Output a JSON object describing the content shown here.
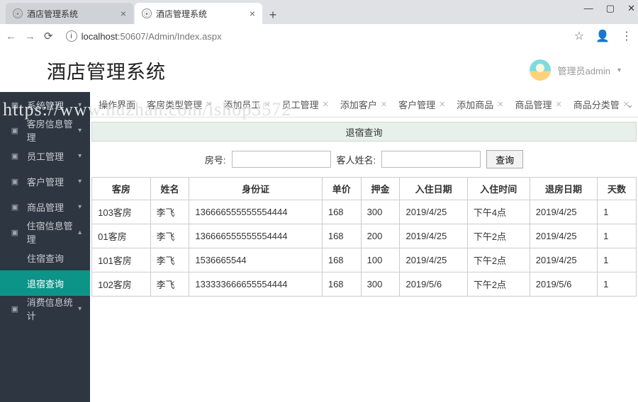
{
  "browser": {
    "tab1_title": "酒店管理系统",
    "tab2_title": "酒店管理系统",
    "url_host": "localhost",
    "url_rest": ":50607/Admin/Index.aspx"
  },
  "header": {
    "app_title": "酒店管理系统",
    "user_label": "管理员admin"
  },
  "watermark": "https://www.huzhan.com/ishop3572",
  "sidebar": {
    "items": [
      {
        "label": "系统管理",
        "icon": "▦",
        "expand": "down"
      },
      {
        "label": "客房信息管理",
        "icon": "▣",
        "expand": "down"
      },
      {
        "label": "员工管理",
        "icon": "▣",
        "expand": "down"
      },
      {
        "label": "客户管理",
        "icon": "▣",
        "expand": "down"
      },
      {
        "label": "商品管理",
        "icon": "▣",
        "expand": "down"
      },
      {
        "label": "住宿信息管理",
        "icon": "▣",
        "expand": "up"
      },
      {
        "label": "住宿查询",
        "sub": true
      },
      {
        "label": "退宿查询",
        "sub": true,
        "active": true
      },
      {
        "label": "消费信息统计",
        "icon": "▣",
        "expand": "down"
      }
    ]
  },
  "content_tabs": [
    "操作界面",
    "客房类型管理",
    "添加员工",
    "员工管理",
    "添加客户",
    "客户管理",
    "添加商品",
    "商品管理",
    "商品分类管"
  ],
  "panel": {
    "title": "退宿查询",
    "search": {
      "room_label": "房号:",
      "name_label": "客人姓名:",
      "button": "查询"
    }
  },
  "table": {
    "headers": [
      "客房",
      "姓名",
      "身份证",
      "单价",
      "押金",
      "入住日期",
      "入住时间",
      "退房日期",
      "天数"
    ],
    "rows": [
      {
        "c0": "103客房",
        "c1": "李飞",
        "c2": "136666555555554444",
        "c3": "168",
        "c4": "300",
        "c5": "2019/4/25",
        "c6": "下午4点",
        "c7": "2019/4/25",
        "c8": "1"
      },
      {
        "c0": "01客房",
        "c1": "李飞",
        "c2": "136666555555554444",
        "c3": "168",
        "c4": "200",
        "c5": "2019/4/25",
        "c6": "下午2点",
        "c7": "2019/4/25",
        "c8": "1"
      },
      {
        "c0": "101客房",
        "c1": "李飞",
        "c2": "1536665544",
        "c3": "168",
        "c4": "100",
        "c5": "2019/4/25",
        "c6": "下午2点",
        "c7": "2019/4/25",
        "c8": "1"
      },
      {
        "c0": "102客房",
        "c1": "李飞",
        "c2": "133333666655554444",
        "c3": "168",
        "c4": "300",
        "c5": "2019/5/6",
        "c6": "下午2点",
        "c7": "2019/5/6",
        "c8": "1"
      }
    ]
  }
}
